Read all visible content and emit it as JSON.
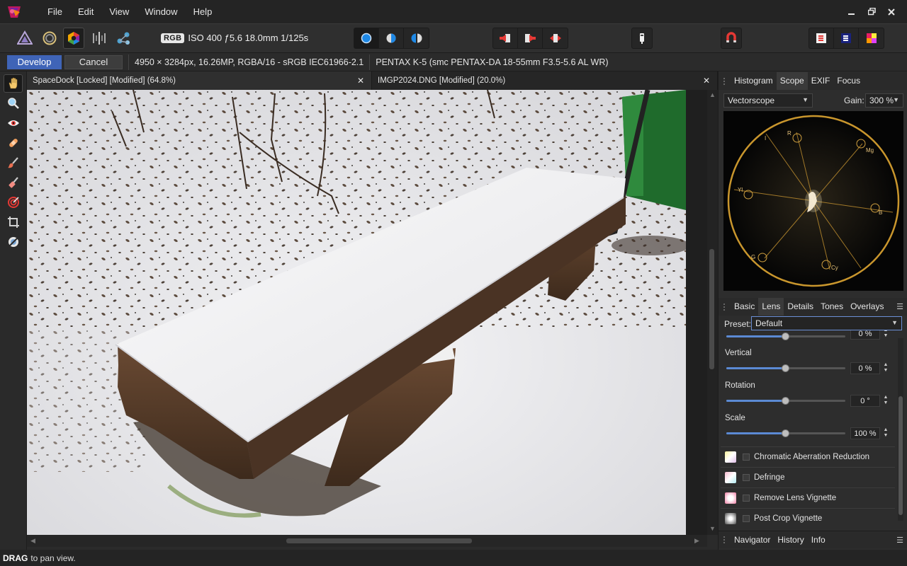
{
  "menu": [
    "File",
    "Edit",
    "View",
    "Window",
    "Help"
  ],
  "toolbar": {
    "color_format": "RGB",
    "exposure_info": "ISO 400 ƒ5.6 18.0mm 1/125s"
  },
  "context": {
    "develop_label": "Develop",
    "cancel_label": "Cancel",
    "image_info": "4950 × 3284px, 16.26MP, RGBA/16 - sRGB IEC61966-2.1",
    "camera_info": "PENTAX K-5 (smc PENTAX-DA 18-55mm F3.5-5.6 AL WR)"
  },
  "documents": [
    {
      "title": "SpaceDock [Locked] [Modified] (64.8%)",
      "active": true
    },
    {
      "title": "IMGP2024.DNG [Modified] (20.0%)",
      "active": false
    }
  ],
  "status": {
    "action": "DRAG",
    "hint": "to pan view."
  },
  "scope_panel": {
    "tabs": [
      "Histogram",
      "Scope",
      "EXIF",
      "Focus"
    ],
    "active_tab": "Scope",
    "mode": "Vectorscope",
    "gain_label": "Gain:",
    "gain_value": "300 %",
    "targets": [
      "R",
      "Mg",
      "B",
      "Cy",
      "G",
      "Yl",
      "I"
    ]
  },
  "develop_panel": {
    "tabs": [
      "Basic",
      "Lens",
      "Details",
      "Tones",
      "Overlays"
    ],
    "active_tab": "Lens",
    "preset_label": "Preset:",
    "preset_value": "Default",
    "partial_value": "0 %",
    "sliders": [
      {
        "label": "Vertical",
        "value": "0 %",
        "position": 0.5
      },
      {
        "label": "Rotation",
        "value": "0 °",
        "position": 0.5
      },
      {
        "label": "Scale",
        "value": "100 %",
        "position": 0.5
      }
    ],
    "options": [
      {
        "label": "Chromatic Aberration Reduction",
        "checked": false
      },
      {
        "label": "Defringe",
        "checked": false
      },
      {
        "label": "Remove Lens Vignette",
        "checked": false
      },
      {
        "label": "Post Crop Vignette",
        "checked": false
      }
    ]
  },
  "bottom_panel": {
    "tabs": [
      "Navigator",
      "History",
      "Info"
    ]
  }
}
